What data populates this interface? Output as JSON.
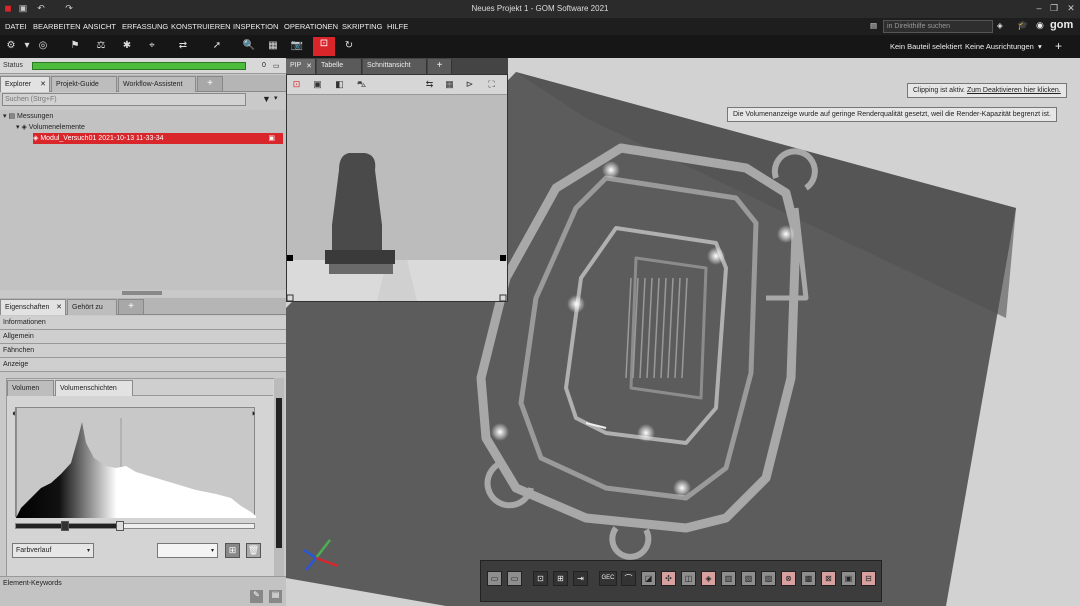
{
  "window": {
    "title": "Neues Projekt 1 - GOM Software 2021"
  },
  "menu": {
    "items": [
      "DATEI",
      "BEARBEITEN",
      "ANSICHT",
      "ERFASSUNG",
      "KONSTRUIEREN",
      "INSPEKTION",
      "OPERATIONEN",
      "SKRIPTING",
      "HILFE"
    ],
    "search_placeholder": "in Direkthilfe suchen"
  },
  "toolbar": {
    "part_status": "Kein Bauteil selektiert",
    "alignment_status": "Keine Ausrichtungen"
  },
  "status": {
    "label": "Status",
    "count": "0"
  },
  "explorer": {
    "tabs": [
      "Explorer",
      "Projekt-Guide",
      "Workflow-Assistent"
    ],
    "search_placeholder": "Suchen (Strg+F)",
    "tree": {
      "root": "Messungen",
      "child": "Volumenelemente",
      "leaf": "Modul_Versuch01 2021-10-13 11-33-34"
    }
  },
  "properties": {
    "tabs": [
      "Eigenschaften",
      "Gehört zu"
    ],
    "sections": [
      "Informationen",
      "Allgemein",
      "Fähnchen",
      "Anzeige"
    ],
    "subtabs": [
      "Volumen",
      "Volumenschichten"
    ],
    "colormap": "Farbverlauf",
    "keywords_label": "Element-Keywords"
  },
  "viewport": {
    "tabs": [
      "PIP",
      "Tabelle",
      "Schnittansicht"
    ],
    "clipping_text": "Clipping ist aktiv.",
    "clipping_link": "Zum Deaktivieren hier klicken.",
    "render_notice": "Die Volumenanzeige wurde auf geringe Renderqualität gesetzt, weil die Render-Kapazität begrenzt ist.",
    "bottom_toolbar_labels": [
      "GEC"
    ]
  },
  "colors": {
    "accent": "#d8262b",
    "status_bar": "#4dbb3c"
  },
  "icons": [
    "window-close-icon",
    "save-icon",
    "undo-icon",
    "redo-icon",
    "search-icon",
    "camera-icon",
    "refresh-icon",
    "home-icon",
    "help-icon",
    "gear-icon",
    "plus-icon",
    "filter-icon",
    "delete-icon",
    "axis-triad-icon"
  ]
}
